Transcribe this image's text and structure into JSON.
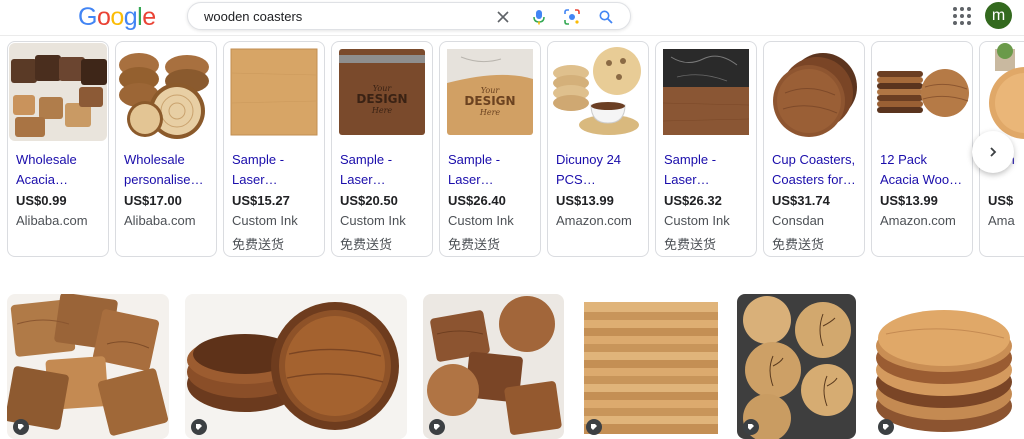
{
  "search": {
    "query": "wooden coasters"
  },
  "user": {
    "initial": "m"
  },
  "logo": {
    "letters": [
      "G",
      "o",
      "o",
      "g",
      "l",
      "e"
    ],
    "colors": [
      "#4285F4",
      "#EA4335",
      "#FBBC05",
      "#4285F4",
      "#34A853",
      "#EA4335"
    ]
  },
  "products": [
    {
      "title1": "Wholesale",
      "title2": "Acacia…",
      "price": "US$0.99",
      "store": "Alibaba.com",
      "shipping": ""
    },
    {
      "title1": "Wholesale",
      "title2": "personalise…",
      "price": "US$17.00",
      "store": "Alibaba.com",
      "shipping": ""
    },
    {
      "title1": "Sample -",
      "title2": "Laser…",
      "price": "US$15.27",
      "store": "Custom Ink",
      "shipping": "免费送货"
    },
    {
      "title1": "Sample -",
      "title2": "Laser…",
      "price": "US$20.50",
      "store": "Custom Ink",
      "shipping": "免费送货"
    },
    {
      "title1": "Sample -",
      "title2": "Laser…",
      "price": "US$26.40",
      "store": "Custom Ink",
      "shipping": "免费送货"
    },
    {
      "title1": "Dicunoy 24",
      "title2": "PCS…",
      "price": "US$13.99",
      "store": "Amazon.com",
      "shipping": ""
    },
    {
      "title1": "Sample -",
      "title2": "Laser…",
      "price": "US$26.32",
      "store": "Custom Ink",
      "shipping": "免费送货"
    },
    {
      "title1": "Cup Coasters,",
      "title2": "Coasters for…",
      "price": "US$31.74",
      "store": "Consdan",
      "shipping": "免费送货"
    },
    {
      "title1": "12 Pack",
      "title2": "Acacia Woo…",
      "price": "US$13.99",
      "store": "Amazon.com",
      "shipping": ""
    },
    {
      "title1": "Bam",
      "title2": "",
      "price": "US$",
      "store": "Ama",
      "shipping": ""
    }
  ],
  "engraved_text": {
    "line1": "Your",
    "line2": "DESIGN",
    "line3": "Here"
  },
  "colors": {
    "link": "#1a0dab",
    "wood_dark": "#7a4a2a",
    "wood_mid": "#a86b3c",
    "wood_light": "#d4a36a"
  }
}
